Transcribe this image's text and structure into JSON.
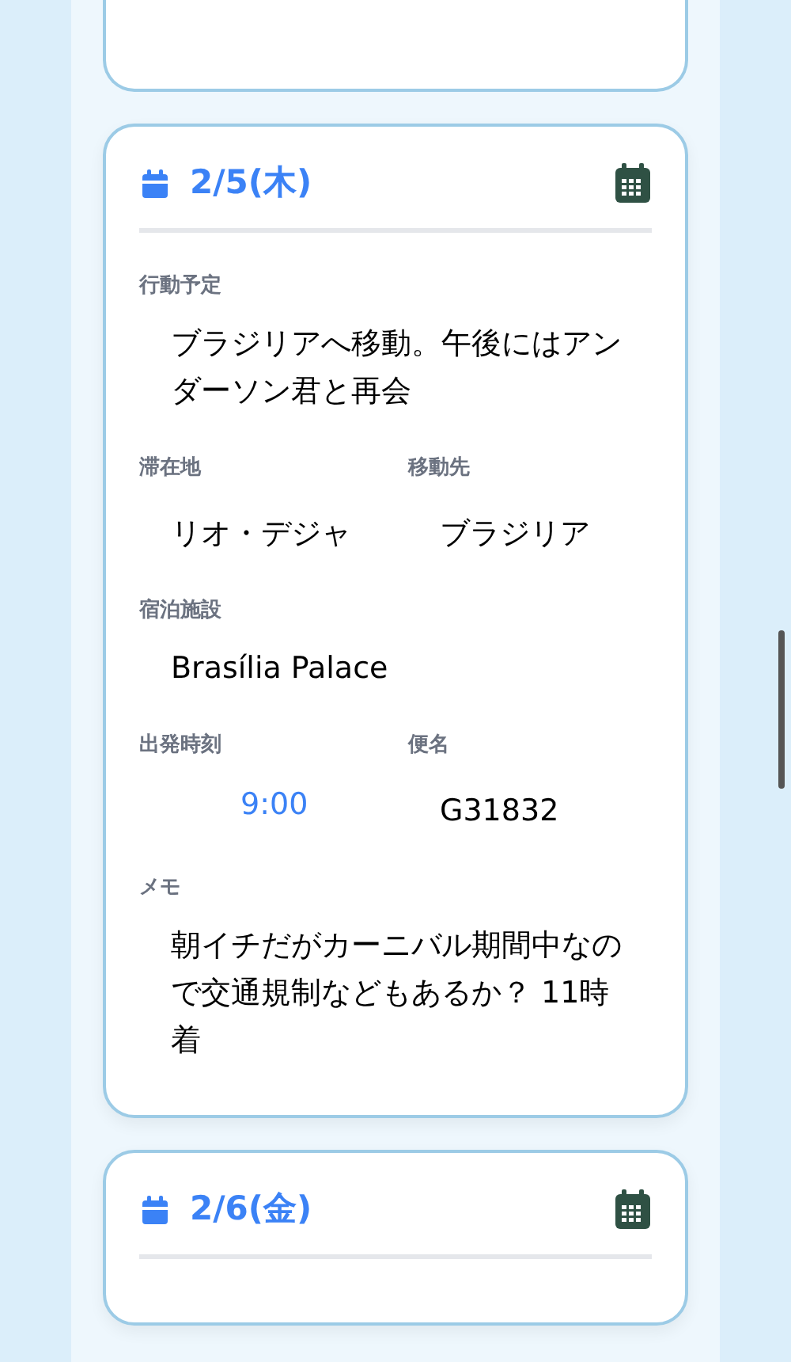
{
  "days": [
    {
      "date": "2/5(木)",
      "fields": [
        {
          "kind": "wide",
          "label": "行動予定",
          "value": "ブラジリアへ移動。午後にはアンダーソン君と再会"
        },
        {
          "kind": "half",
          "label": "滞在地",
          "value": "リオ・デジャ"
        },
        {
          "kind": "half",
          "label": "移動先",
          "value": "ブラジリア"
        },
        {
          "kind": "wide",
          "label": "宿泊施設",
          "value": "Brasília Palace"
        },
        {
          "kind": "time",
          "label": "出発時刻",
          "value": "9:00"
        },
        {
          "kind": "half",
          "label": "便名",
          "value": "G31832"
        },
        {
          "kind": "wide",
          "label": "メモ",
          "value": "朝イチだがカーニバル期間中なので交通規制などもあるか？ 11時着"
        }
      ]
    },
    {
      "date": "2/6(金)"
    }
  ]
}
